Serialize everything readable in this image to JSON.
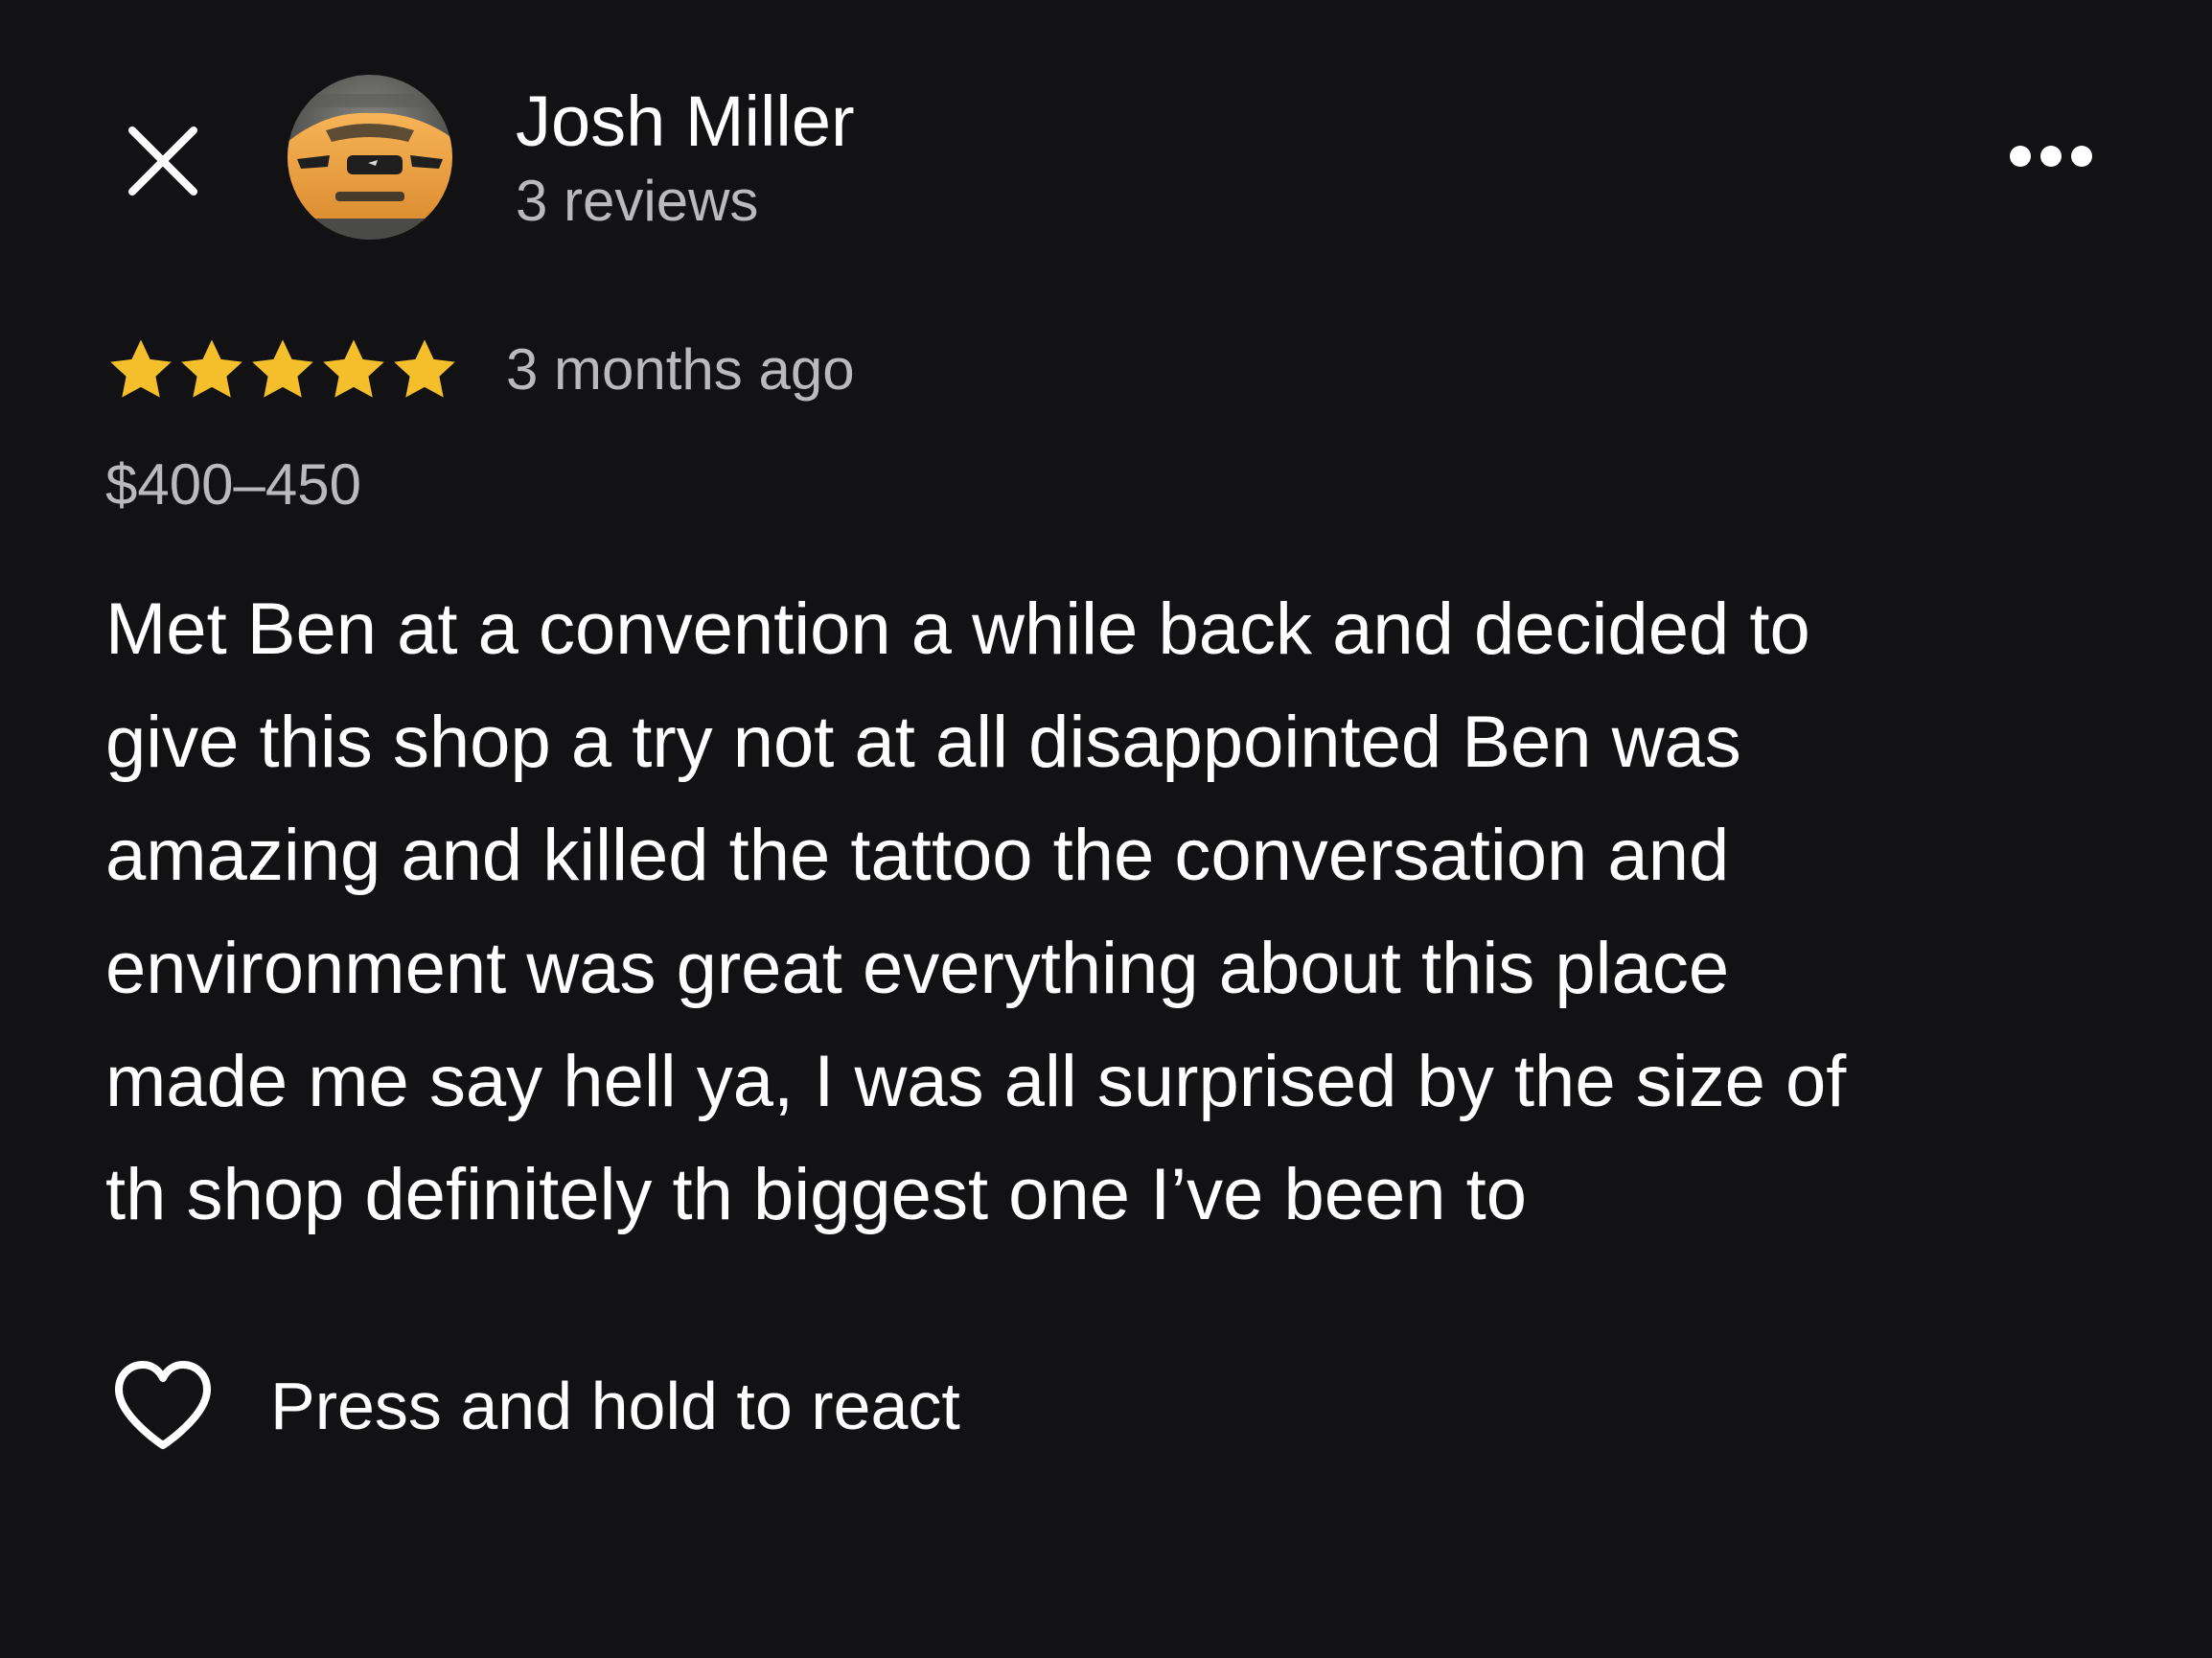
{
  "header": {
    "close_icon": "close-icon",
    "avatar_icon": "car-avatar",
    "reviewer_name": "Josh Miller",
    "review_count": "3 reviews",
    "more_icon": "more-horizontal-icon"
  },
  "review": {
    "rating": 5,
    "rating_max": 5,
    "star_color": "#f4bf2a",
    "time_ago": "3 months ago",
    "price_range": "$400–450",
    "text": "Met Ben at a convention a while back and decided to\ngive this shop a try not at all disappointed Ben was\namazing and killed the tattoo the conversation and\nenvironment was great everything about this place\nmade me say hell ya, I was all surprised by the size of\nth shop definitely th biggest one I’ve been to"
  },
  "reaction": {
    "icon": "heart-outline-icon",
    "label": "Press and hold to react"
  },
  "colors": {
    "background": "#121214",
    "primary_text": "#ffffff",
    "secondary_text": "#b9b9be",
    "avatar_car": "#f2a849"
  }
}
